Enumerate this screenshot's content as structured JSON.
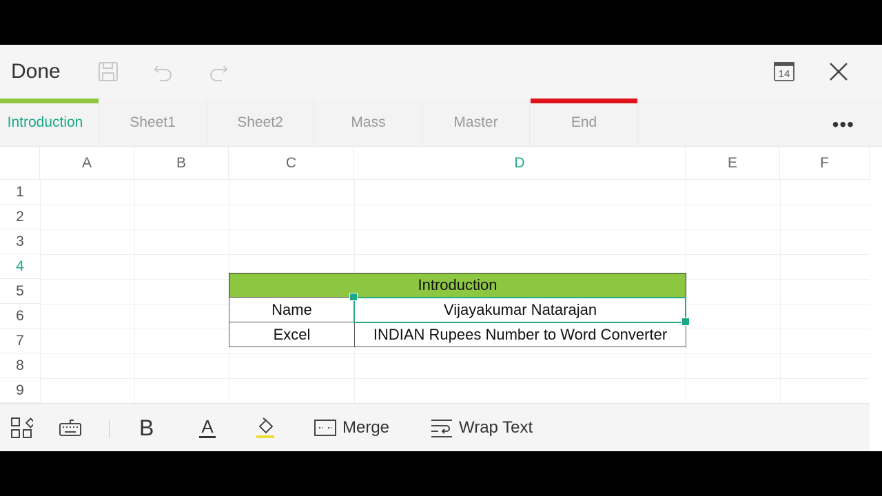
{
  "toolbar": {
    "done_label": "Done",
    "font_size_badge": "14",
    "icons": [
      "save-icon",
      "undo-icon",
      "redo-icon",
      "font-size-icon",
      "close-icon"
    ]
  },
  "tabs": [
    {
      "label": "Introduction",
      "bar_color": "#8dc641",
      "active": true
    },
    {
      "label": "Sheet1",
      "bar_color": "",
      "active": false
    },
    {
      "label": "Sheet2",
      "bar_color": "",
      "active": false
    },
    {
      "label": "Mass",
      "bar_color": "",
      "active": false
    },
    {
      "label": "Master",
      "bar_color": "",
      "active": false
    },
    {
      "label": "End",
      "bar_color": "#e0121b",
      "active": false
    }
  ],
  "more_label": "•••",
  "columns": [
    "A",
    "B",
    "C",
    "D",
    "E",
    "F"
  ],
  "active_column": "D",
  "rows": [
    "1",
    "2",
    "3",
    "4",
    "5",
    "6",
    "7",
    "8",
    "9"
  ],
  "active_row": "4",
  "table": {
    "header": "Introduction",
    "rows": [
      {
        "label": "Name",
        "value": "Vijayakumar Natarajan"
      },
      {
        "label": "Excel",
        "value": "INDIAN Rupees Number to Word Converter"
      }
    ]
  },
  "bottom": {
    "bold_label": "B",
    "font_color_label": "A",
    "merge_label": "Merge",
    "wrap_label": "Wrap Text"
  },
  "colors": {
    "accent": "#1aaa88",
    "header_fill": "#8dc641",
    "end_tab": "#e0121b"
  }
}
